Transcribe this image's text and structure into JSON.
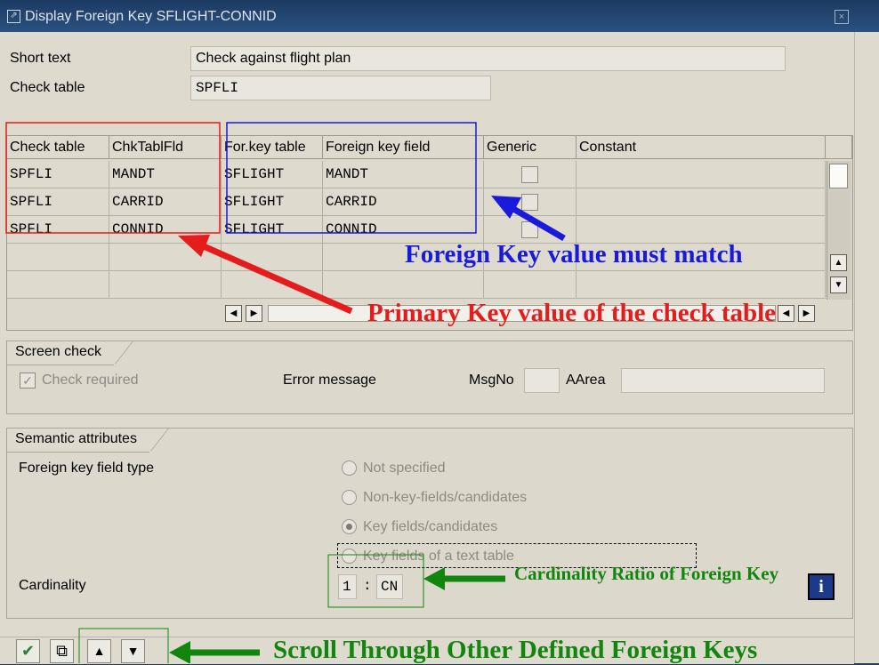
{
  "window": {
    "title": "Display Foreign Key SFLIGHT-CONNID"
  },
  "header": {
    "short_text_label": "Short text",
    "short_text_value": "Check against flight plan",
    "check_table_label": "Check table",
    "check_table_value": "SPFLI"
  },
  "table": {
    "columns": [
      "Check table",
      "ChkTablFld",
      "For.key table",
      "Foreign key field",
      "Generic",
      "Constant"
    ],
    "rows": [
      [
        "SPFLI",
        "MANDT",
        "SFLIGHT",
        "MANDT"
      ],
      [
        "SPFLI",
        "CARRID",
        "SFLIGHT",
        "CARRID"
      ],
      [
        "SPFLI",
        "CONNID",
        "SFLIGHT",
        "CONNID"
      ]
    ]
  },
  "screen_check": {
    "title": "Screen check",
    "check_required": "Check required",
    "error_message": "Error message",
    "msgno": "MsgNo",
    "aarea": "AArea"
  },
  "semantic": {
    "title": "Semantic attributes",
    "fk_field_type": "Foreign key field type",
    "options": [
      "Not specified",
      "Non-key-fields/candidates",
      "Key fields/candidates",
      "Key fields of a text table"
    ],
    "selected_option": "Key fields/candidates",
    "cardinality_label": "Cardinality",
    "card_left": "1",
    "card_sep": ":",
    "card_right": "CN"
  },
  "annotations": {
    "foreign": "Foreign Key value must match",
    "primary": "Primary Key value of the check table",
    "cardinality": "Cardinality Ratio of Foreign Key",
    "scroll": "Scroll Through Other Defined Foreign Keys"
  },
  "colors": {
    "red": "#e51c1c",
    "blue": "#1a1adb",
    "green": "#12850f",
    "title_bg": "#1c3b63"
  }
}
